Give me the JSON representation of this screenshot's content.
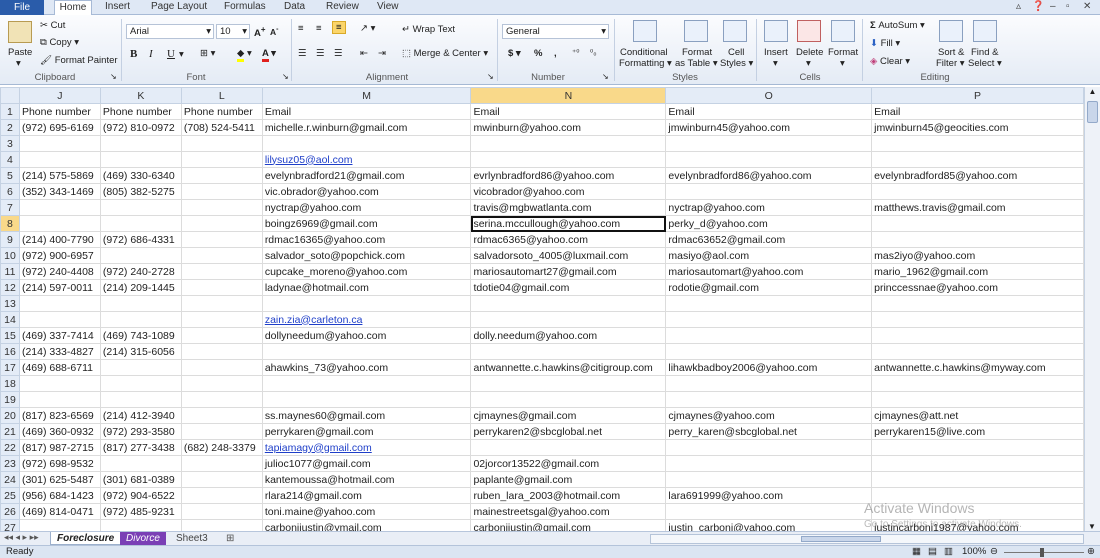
{
  "ribbon_tabs": [
    "File",
    "Home",
    "Insert",
    "Page Layout",
    "Formulas",
    "Data",
    "Review",
    "View"
  ],
  "clipboard": {
    "paste": "Paste",
    "cut": "Cut",
    "copy": "Copy",
    "format_painter": "Format Painter",
    "label": "Clipboard"
  },
  "font": {
    "name": "Arial",
    "size": "10",
    "label": "Font",
    "bold": "B",
    "italic": "I",
    "underline": "U"
  },
  "alignment": {
    "wrap_text": "Wrap Text",
    "merge_center": "Merge & Center",
    "label": "Alignment"
  },
  "number": {
    "format": "General",
    "dollar": "$",
    "percent": "%",
    "comma": ",",
    "label": "Number"
  },
  "styles": {
    "conditional": "Conditional",
    "formatting": "Formatting",
    "format_as": "Format",
    "as_table": "as Table",
    "cell": "Cell",
    "cell_styles": "Styles",
    "label": "Styles"
  },
  "cells": {
    "insert": "Insert",
    "delete": "Delete",
    "format": "Format",
    "label": "Cells"
  },
  "editing": {
    "autosum": "AutoSum",
    "fill": "Fill",
    "clear": "Clear",
    "sort": "Sort &",
    "filter": "Filter",
    "find": "Find &",
    "select": "Select",
    "label": "Editing"
  },
  "columns": [
    "J",
    "K",
    "L",
    "M",
    "N",
    "O",
    "P"
  ],
  "selected_column": "N",
  "selected_row": "8",
  "rows": [
    {
      "n": "1",
      "J": "Phone number",
      "K": "Phone number",
      "L": "Phone number",
      "M": "Email",
      "N": "Email",
      "O": "Email",
      "P": "Email"
    },
    {
      "n": "2",
      "J": "(972) 695-6169",
      "K": "(972) 810-0972",
      "L": "(708) 524-5411",
      "M": "michelle.r.winburn@gmail.com",
      "N": "mwinburn@yahoo.com",
      "O": "jmwinburn45@yahoo.com",
      "P": "jmwinburn45@geocities.com"
    },
    {
      "n": "3",
      "J": "",
      "K": "",
      "L": "",
      "M": "",
      "N": "",
      "O": "",
      "P": ""
    },
    {
      "n": "4",
      "J": "",
      "K": "",
      "L": "",
      "M": "lilysuz05@aol.com",
      "N": "",
      "O": "",
      "P": "",
      "link": "M"
    },
    {
      "n": "5",
      "J": "(214) 575-5869",
      "K": "(469) 330-6340",
      "L": "",
      "M": "evelynbradford21@gmail.com",
      "N": "evrlynbradford86@yahoo.com",
      "O": "evelynbradford86@yahoo.com",
      "P": "evelynbradford85@yahoo.com"
    },
    {
      "n": "6",
      "J": "(352) 343-1469",
      "K": "(805) 382-5275",
      "L": "",
      "M": "vic.obrador@yahoo.com",
      "N": "vicobrador@yahoo.com",
      "O": "",
      "P": ""
    },
    {
      "n": "7",
      "J": "",
      "K": "",
      "L": "",
      "M": "nyctrap@yahoo.com",
      "N": "travis@mgbwatlanta.com",
      "O": "nyctrap@yahoo.com",
      "P": "matthews.travis@gmail.com"
    },
    {
      "n": "8",
      "J": "",
      "K": "",
      "L": "",
      "M": "boingz6969@gmail.com",
      "N": "serina.mccullough@yahoo.com",
      "O": "perky_d@yahoo.com",
      "P": ""
    },
    {
      "n": "9",
      "J": "(214) 400-7790",
      "K": "(972) 686-4331",
      "L": "",
      "M": "rdmac16365@yahoo.com",
      "N": "rdmac6365@yahoo.com",
      "O": "rdmac63652@gmail.com",
      "P": ""
    },
    {
      "n": "10",
      "J": "(972) 900-6957",
      "K": "",
      "L": "",
      "M": "salvador_soto@popchick.com",
      "N": "salvadorsoto_4005@luxmail.com",
      "O": "masiyo@aol.com",
      "P": "mas2iyo@yahoo.com"
    },
    {
      "n": "11",
      "J": "(972) 240-4408",
      "K": "(972) 240-2728",
      "L": "",
      "M": "cupcake_moreno@yahoo.com",
      "N": "mariosautomart27@gmail.com",
      "O": "mariosautomart@yahoo.com",
      "P": "mario_1962@gmail.com"
    },
    {
      "n": "12",
      "J": "(214) 597-0011",
      "K": "(214) 209-1445",
      "L": "",
      "M": "ladynae@hotmail.com",
      "N": "tdotie04@gmail.com",
      "O": "rodotie@gmail.com",
      "P": "princcessnae@yahoo.com"
    },
    {
      "n": "13",
      "J": "",
      "K": "",
      "L": "",
      "M": "",
      "N": "",
      "O": "",
      "P": ""
    },
    {
      "n": "14",
      "J": "",
      "K": "",
      "L": "",
      "M": "zain.zia@carleton.ca",
      "N": "",
      "O": "",
      "P": "",
      "link": "M"
    },
    {
      "n": "15",
      "J": "(469) 337-7414",
      "K": "(469) 743-1089",
      "L": "",
      "M": "dollyneedum@yahoo.com",
      "N": "dolly.needum@yahoo.com",
      "O": "",
      "P": ""
    },
    {
      "n": "16",
      "J": "(214) 333-4827",
      "K": "(214) 315-6056",
      "L": "",
      "M": "",
      "N": "",
      "O": "",
      "P": ""
    },
    {
      "n": "17",
      "J": "(469) 688-6711",
      "K": "",
      "L": "",
      "M": "ahawkins_73@yahoo.com",
      "N": "antwannette.c.hawkins@citigroup.com",
      "O": "lihawkbadboy2006@yahoo.com",
      "P": "antwannette.c.hawkins@myway.com"
    },
    {
      "n": "18",
      "J": "",
      "K": "",
      "L": "",
      "M": "",
      "N": "",
      "O": "",
      "P": ""
    },
    {
      "n": "19",
      "J": "",
      "K": "",
      "L": "",
      "M": "",
      "N": "",
      "O": "",
      "P": ""
    },
    {
      "n": "20",
      "J": "(817) 823-6569",
      "K": "(214) 412-3940",
      "L": "",
      "M": "ss.maynes60@gmail.com",
      "N": "cjmaynes@gmail.com",
      "O": "cjmaynes@yahoo.com",
      "P": "cjmaynes@att.net"
    },
    {
      "n": "21",
      "J": "(469) 360-0932",
      "K": "(972) 293-3580",
      "L": "",
      "M": "perrykaren@gmail.com",
      "N": "perrykaren2@sbcglobal.net",
      "O": "perry_karen@sbcglobal.net",
      "P": "perrykaren15@live.com"
    },
    {
      "n": "22",
      "J": "(817) 987-2715",
      "K": "(817) 277-3438",
      "L": "(682) 248-3379",
      "M": "tapiamagy@gmail.com",
      "N": "",
      "O": "",
      "P": "",
      "link": "M"
    },
    {
      "n": "23",
      "J": "(972) 698-9532",
      "K": "",
      "L": "",
      "M": "julioc1077@gmail.com",
      "N": "02jorcor13522@gmail.com",
      "O": "",
      "P": ""
    },
    {
      "n": "24",
      "J": "(301) 625-5487",
      "K": "(301) 681-0389",
      "L": "",
      "M": "kantemoussa@hotmail.com",
      "N": "paplante@gmail.com",
      "O": "",
      "P": ""
    },
    {
      "n": "25",
      "J": "(956) 684-1423",
      "K": "(972) 904-6522",
      "L": "",
      "M": "rlara214@gmail.com",
      "N": "ruben_lara_2003@hotmail.com",
      "O": "lara691999@yahoo.com",
      "P": ""
    },
    {
      "n": "26",
      "J": "(469) 814-0471",
      "K": "(972) 485-9231",
      "L": "",
      "M": "toni.maine@yahoo.com",
      "N": "mainestreetsgal@yahoo.com",
      "O": "",
      "P": ""
    },
    {
      "n": "27",
      "J": "",
      "K": "",
      "L": "",
      "M": "carbonijustin@ymail.com",
      "N": "carbonijustin@gmail.com",
      "O": "justin_carboni@yahoo.com",
      "P": "justincarboni1987@yahoo.com"
    }
  ],
  "sheet_tabs": [
    "Foreclosure",
    "Divorce",
    "Sheet3"
  ],
  "status": {
    "ready": "Ready",
    "zoom": "100%"
  },
  "watermark": {
    "title": "Activate Windows",
    "subtitle": "Go to Settings to activate Windows."
  }
}
